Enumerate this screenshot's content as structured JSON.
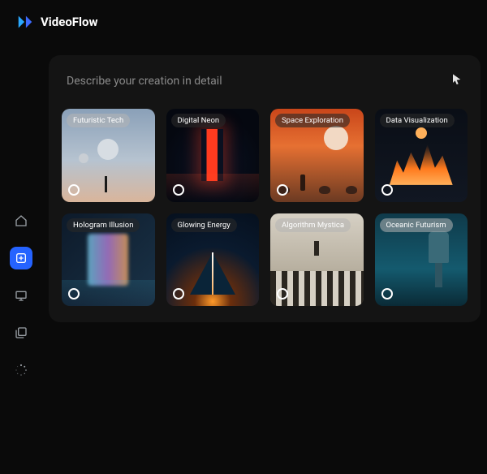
{
  "header": {
    "brand": "VideoFlow"
  },
  "prompt": {
    "placeholder": "Describe your creation in detail",
    "value": ""
  },
  "sidebar": {
    "items": [
      {
        "name": "home-icon",
        "active": false
      },
      {
        "name": "create-icon",
        "active": true
      },
      {
        "name": "display-icon",
        "active": false
      },
      {
        "name": "library-icon",
        "active": false
      },
      {
        "name": "loading-icon",
        "active": false
      }
    ]
  },
  "cards": [
    {
      "label": "Futuristic Tech",
      "tone": "light"
    },
    {
      "label": "Digital Neon",
      "tone": "dark"
    },
    {
      "label": "Space Exploration",
      "tone": "dark"
    },
    {
      "label": "Data Visualization",
      "tone": "dark"
    },
    {
      "label": "Hologram Illusion",
      "tone": "dark"
    },
    {
      "label": "Glowing Energy",
      "tone": "dark"
    },
    {
      "label": "Algorithm Mystica",
      "tone": "light"
    },
    {
      "label": "Oceanic Futurism",
      "tone": "light"
    }
  ],
  "colors": {
    "accent": "#2563ff",
    "background": "#0a0a0a",
    "panel": "#141414"
  }
}
